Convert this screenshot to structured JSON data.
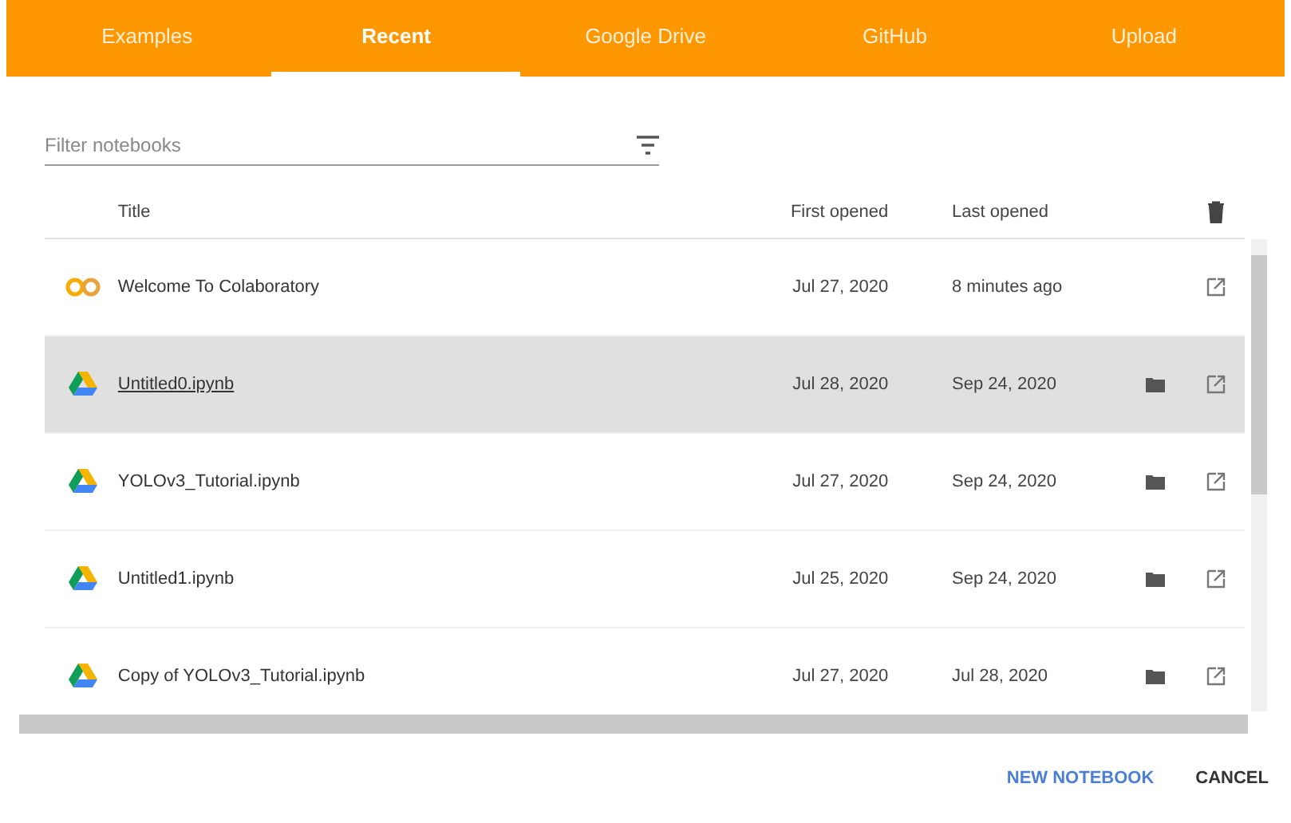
{
  "tabs": [
    {
      "label": "Examples",
      "selected": false
    },
    {
      "label": "Recent",
      "selected": true
    },
    {
      "label": "Google Drive",
      "selected": false
    },
    {
      "label": "GitHub",
      "selected": false
    },
    {
      "label": "Upload",
      "selected": false
    }
  ],
  "filter": {
    "placeholder": "Filter notebooks"
  },
  "table": {
    "columns": [
      "Title",
      "First opened",
      "Last opened"
    ],
    "rows": [
      {
        "kind": "colab",
        "title": "Welcome To Colaboratory",
        "first_opened": "Jul 27, 2020",
        "last_opened": "8 minutes ago",
        "selected": false
      },
      {
        "kind": "drive",
        "title": "Untitled0.ipynb",
        "first_opened": "Jul 28, 2020",
        "last_opened": "Sep 24, 2020",
        "selected": true
      },
      {
        "kind": "drive",
        "title": "YOLOv3_Tutorial.ipynb",
        "first_opened": "Jul 27, 2020",
        "last_opened": "Sep 24, 2020",
        "selected": false
      },
      {
        "kind": "drive",
        "title": "Untitled1.ipynb",
        "first_opened": "Jul 25, 2020",
        "last_opened": "Sep 24, 2020",
        "selected": false
      },
      {
        "kind": "drive",
        "title": "Copy of YOLOv3_Tutorial.ipynb",
        "first_opened": "Jul 27, 2020",
        "last_opened": "Jul 28, 2020",
        "selected": false
      }
    ]
  },
  "buttons": [
    {
      "kind": "primary",
      "label": "NEW NOTEBOOK"
    },
    {
      "kind": "plain",
      "label": "CANCEL"
    }
  ]
}
